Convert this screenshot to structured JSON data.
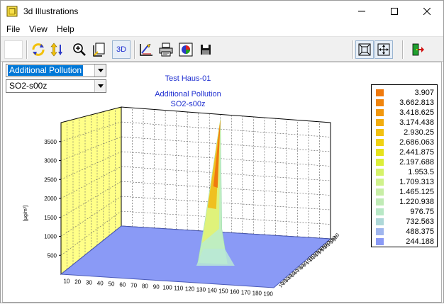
{
  "window": {
    "title": "3d Illustrations"
  },
  "menu": {
    "items": [
      "File",
      "View",
      "Help"
    ]
  },
  "toolbar": {
    "mode_3d_label": "3D"
  },
  "selectors": {
    "variable": "Additional Pollution",
    "substance": "SO2-s00z"
  },
  "chart_titles": {
    "line1": "Test Haus-01",
    "line2": "Additional Pollution",
    "line3": "SO2-s00z"
  },
  "legend": [
    {
      "label": "3.907",
      "color": "#f07a0e"
    },
    {
      "label": "3.662.813",
      "color": "#f0850e"
    },
    {
      "label": "3.418.625",
      "color": "#f2980f"
    },
    {
      "label": "3.174.438",
      "color": "#f2ad10"
    },
    {
      "label": "2.930.25",
      "color": "#f2c112"
    },
    {
      "label": "2.686.063",
      "color": "#f0d214"
    },
    {
      "label": "2.441.875",
      "color": "#e6e21c"
    },
    {
      "label": "2.197.688",
      "color": "#dcee3a"
    },
    {
      "label": "1.953.5",
      "color": "#d6f26a"
    },
    {
      "label": "1.709.313",
      "color": "#d0f28c"
    },
    {
      "label": "1.465.125",
      "color": "#c8eea6"
    },
    {
      "label": "1.220.938",
      "color": "#c0ebb6"
    },
    {
      "label": "976.75",
      "color": "#b8e8c6"
    },
    {
      "label": "732.563",
      "color": "#aed8d8"
    },
    {
      "label": "488.375",
      "color": "#a0b6ee"
    },
    {
      "label": "244.188",
      "color": "#8a9af6"
    }
  ],
  "chart_data": {
    "type": "surface3d",
    "ylabel": "[µg/m³]",
    "z_ticks": [
      "500",
      "1000",
      "1500",
      "2000",
      "2500",
      "3000",
      "3500"
    ],
    "x_ticks": [
      "10",
      "20",
      "30",
      "40",
      "50",
      "60",
      "70",
      "80",
      "90",
      "100",
      "110",
      "120",
      "130",
      "140",
      "150",
      "160",
      "170",
      "180",
      "190"
    ],
    "y_ticks": [
      "10",
      "20",
      "30",
      "40",
      "50",
      "60",
      "70",
      "80",
      "90",
      "100",
      "110",
      "120",
      "130",
      "140",
      "150",
      "160",
      "170",
      "180",
      "190"
    ],
    "peak": {
      "x": 110,
      "value": 3907
    },
    "wall_color": "#ffff88",
    "floor_color": "#8a9af6"
  }
}
